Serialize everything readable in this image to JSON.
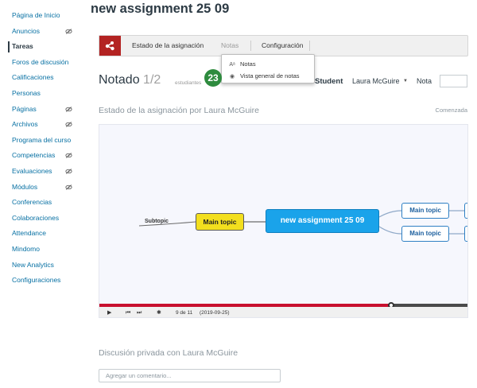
{
  "sidebar": {
    "items": [
      {
        "label": "Página de Inicio",
        "hidden_icon": false,
        "active": false
      },
      {
        "label": "Anuncios",
        "hidden_icon": true,
        "active": false
      },
      {
        "label": "Tareas",
        "hidden_icon": false,
        "active": true
      },
      {
        "label": "Foros de discusión",
        "hidden_icon": false,
        "active": false
      },
      {
        "label": "Calificaciones",
        "hidden_icon": false,
        "active": false
      },
      {
        "label": "Personas",
        "hidden_icon": false,
        "active": false
      },
      {
        "label": "Páginas",
        "hidden_icon": true,
        "active": false
      },
      {
        "label": "Archivos",
        "hidden_icon": true,
        "active": false
      },
      {
        "label": "Programa del curso",
        "hidden_icon": false,
        "active": false
      },
      {
        "label": "Competencias",
        "hidden_icon": true,
        "active": false
      },
      {
        "label": "Evaluaciones",
        "hidden_icon": true,
        "active": false
      },
      {
        "label": "Módulos",
        "hidden_icon": true,
        "active": false
      },
      {
        "label": "Conferencias",
        "hidden_icon": false,
        "active": false
      },
      {
        "label": "Colaboraciones",
        "hidden_icon": false,
        "active": false
      },
      {
        "label": "Attendance",
        "hidden_icon": false,
        "active": false
      },
      {
        "label": "Mindomo",
        "hidden_icon": false,
        "active": false
      },
      {
        "label": "New Analytics",
        "hidden_icon": false,
        "active": false
      },
      {
        "label": "Configuraciones",
        "hidden_icon": false,
        "active": false
      }
    ]
  },
  "page": {
    "title": "new assignment 25 09"
  },
  "toolbar": {
    "tab_status": "Estado de la asignación",
    "tab_notes": "Notas",
    "tab_config": "Configuración",
    "logo_color": "#b32322"
  },
  "dropdown": {
    "item_notes": "Notas",
    "item_overview": "Vista general de notas"
  },
  "badge": {
    "number": "23",
    "color": "#2e8b3e"
  },
  "grading": {
    "graded_label": "Notado",
    "graded_count": "1/2",
    "students_label": "estudiantes",
    "student_label": "Student",
    "student_name": "Laura McGuire",
    "grade_label": "Nota",
    "grade_value": ""
  },
  "status": {
    "title": "Estado de la asignación por Laura McGuire",
    "value": "Comenzada"
  },
  "mindmap": {
    "central": "new assignment 25 09",
    "left_topic": "Main topic",
    "left_subtopic": "Subtopic",
    "right_topic_1": "Main topic",
    "right_topic_2": "Main topic",
    "central_color": "#1aa3ea",
    "yellow_color": "#f3df1e"
  },
  "player": {
    "current_step": 9,
    "total_steps": 11,
    "step_text": "9 de 11",
    "date_text": "(2019-09-25)",
    "progress_fraction": 0.79,
    "progress_color": "#c8102e"
  },
  "discussion": {
    "title": "Discusión privada con Laura McGuire",
    "placeholder": "Agregar un comentario..."
  }
}
